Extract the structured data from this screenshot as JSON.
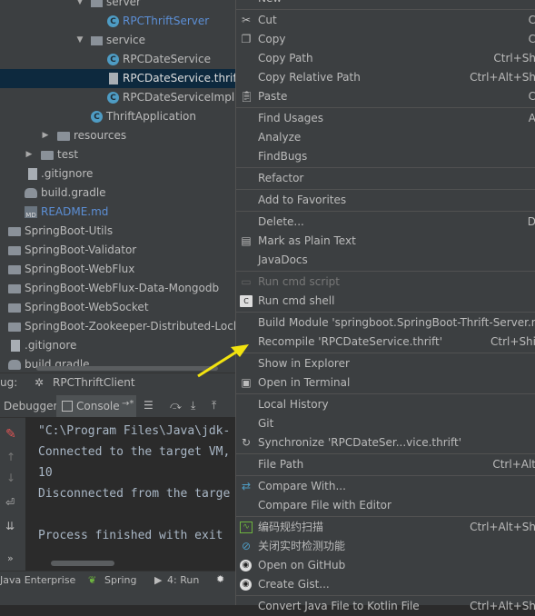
{
  "tree": {
    "server": "server",
    "rpc_thrift_server": "RPCThriftServer",
    "service": "service",
    "rpc_date_service": "RPCDateService",
    "rpc_date_service_thrift": "RPCDateService.thrift",
    "rpc_date_service_impl": "RPCDateServiceImpl",
    "thrift_application": "ThriftApplication",
    "resources": "resources",
    "test": "test",
    "gitignore": ".gitignore",
    "build_gradle": "build.gradle",
    "readme": "README.md",
    "sb_utils": "SpringBoot-Utils",
    "sb_validator": "SpringBoot-Validator",
    "sb_webflux": "SpringBoot-WebFlux",
    "sb_webflux_mongo": "SpringBoot-WebFlux-Data-Mongodb",
    "sb_websocket": "SpringBoot-WebSocket",
    "sb_zookeeper": "SpringBoot-Zookeeper-Distributed-Lock",
    "root_gitignore": ".gitignore",
    "root_build_gradle": "build.gradle"
  },
  "debug": {
    "label": "ug:",
    "tab": "RPCThriftClient",
    "debugger_tab": "Debugger",
    "console_tab": "Console",
    "console_suffix": "→*"
  },
  "console": {
    "line1": "\"C:\\Program Files\\Java\\jdk-",
    "line2": "Connected to the target VM,",
    "line3": "10",
    "line4": "Disconnected from the targe",
    "line5": "Process finished with exit"
  },
  "statusbar": {
    "java_enterprise": "Java Enterprise",
    "spring": "Spring",
    "run": "4: Run"
  },
  "menu": {
    "new": "New",
    "cut": "Cut",
    "cut_sc": "C",
    "copy": "Copy",
    "copy_sc": "C",
    "copy_path": "Copy Path",
    "copy_path_sc": "Ctrl+Sh",
    "copy_rel_path": "Copy Relative Path",
    "copy_rel_path_sc": "Ctrl+Alt+Sh",
    "paste": "Paste",
    "paste_sc": "C",
    "find_usages": "Find Usages",
    "find_usages_sc": "A",
    "analyze": "Analyze",
    "findbugs": "FindBugs",
    "refactor": "Refactor",
    "add_favorites": "Add to Favorites",
    "delete": "Delete...",
    "delete_sc": "D",
    "mark_plain": "Mark as Plain Text",
    "javadocs": "JavaDocs",
    "run_cmd_script": "Run cmd script",
    "run_cmd_shell": "Run cmd shell",
    "build_module": "Build Module 'springboot.SpringBoot-Thrift-Server.m",
    "recompile": "Recompile 'RPCDateService.thrift'",
    "recompile_sc": "Ctrl+Shi",
    "show_explorer": "Show in Explorer",
    "open_terminal": "Open in Terminal",
    "local_history": "Local History",
    "git": "Git",
    "synchronize": "Synchronize 'RPCDateSer...vice.thrift'",
    "file_path": "File Path",
    "file_path_sc": "Ctrl+Alt",
    "compare_with": "Compare With...",
    "compare_editor": "Compare File with Editor",
    "code_scan": "编码规约扫描",
    "code_scan_sc": "Ctrl+Alt+Sh",
    "realtime_off": "关闭实时检测功能",
    "open_github": "Open on GitHub",
    "create_gist": "Create Gist...",
    "convert_kotlin": "Convert Java File to Kotlin File",
    "convert_kotlin_sc": "Ctrl+Alt+Sh"
  },
  "colors": {
    "annotation_arrow": "#f2e30f",
    "selection": "#0d293e",
    "link_blue": "#5c8fd6"
  }
}
